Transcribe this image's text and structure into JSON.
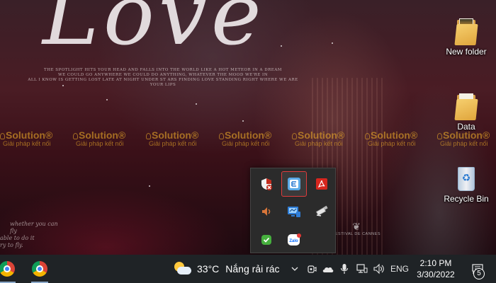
{
  "wallpaper": {
    "script_title": "Love",
    "tagline_lines": [
      "THE SPOTLIGHT HITS YOUR HEAD AND FALLS INTO THE WORLD LIKE A HOT METEOR IN A DREAM",
      "WE COULD GO ANYWHERE WE COULD DO ANYTHING, WHATEVER THE MOOD WE'RE IN",
      "ALL I KNOW IS GETTING LOST LATE AT NIGHT UNDER ST ARS FINDING LOVE STANDING RIGHT WHERE WE ARE YOUR LIPS"
    ],
    "watermark": {
      "brand": "Solution",
      "subtitle": "Giải pháp kết nối"
    },
    "quote_lines": [
      "whether you can fly",
      "able to do it",
      "ry to fly."
    ],
    "cannes_text": "FESTIVAL DE CANNES"
  },
  "desktop_icons": [
    {
      "label": "New folder",
      "icon": "folder-with-photo-icon"
    },
    {
      "label": "Data",
      "icon": "folder-icon"
    },
    {
      "label": "Recycle Bin",
      "icon": "recycle-bin-icon"
    }
  ],
  "tray_popup": {
    "icons": [
      {
        "name": "windows-security-icon"
      },
      {
        "name": "eset-edit-icon",
        "focused": true
      },
      {
        "name": "adobe-acrobat-icon"
      },
      {
        "name": "speaker-icon"
      },
      {
        "name": "network-monitor-icon"
      },
      {
        "name": "usb-safely-remove-icon"
      },
      {
        "name": "shield-check-icon"
      },
      {
        "name": "zalo-icon",
        "label": "Zalo"
      }
    ]
  },
  "taskbar": {
    "apps": [
      {
        "name": "chrome-icon"
      },
      {
        "name": "chrome-profile-icon"
      }
    ],
    "weather": {
      "temperature": "33°C",
      "description": "Nắng rải rác"
    },
    "language": "ENG",
    "time": "2:10 PM",
    "date": "3/30/2022",
    "notification_count": "5"
  },
  "colors": {
    "taskbar": "#1f2326",
    "tray_popup": "#2b2b2b",
    "focus_border": "#e03b3b",
    "watermark": "#ebaa28"
  }
}
